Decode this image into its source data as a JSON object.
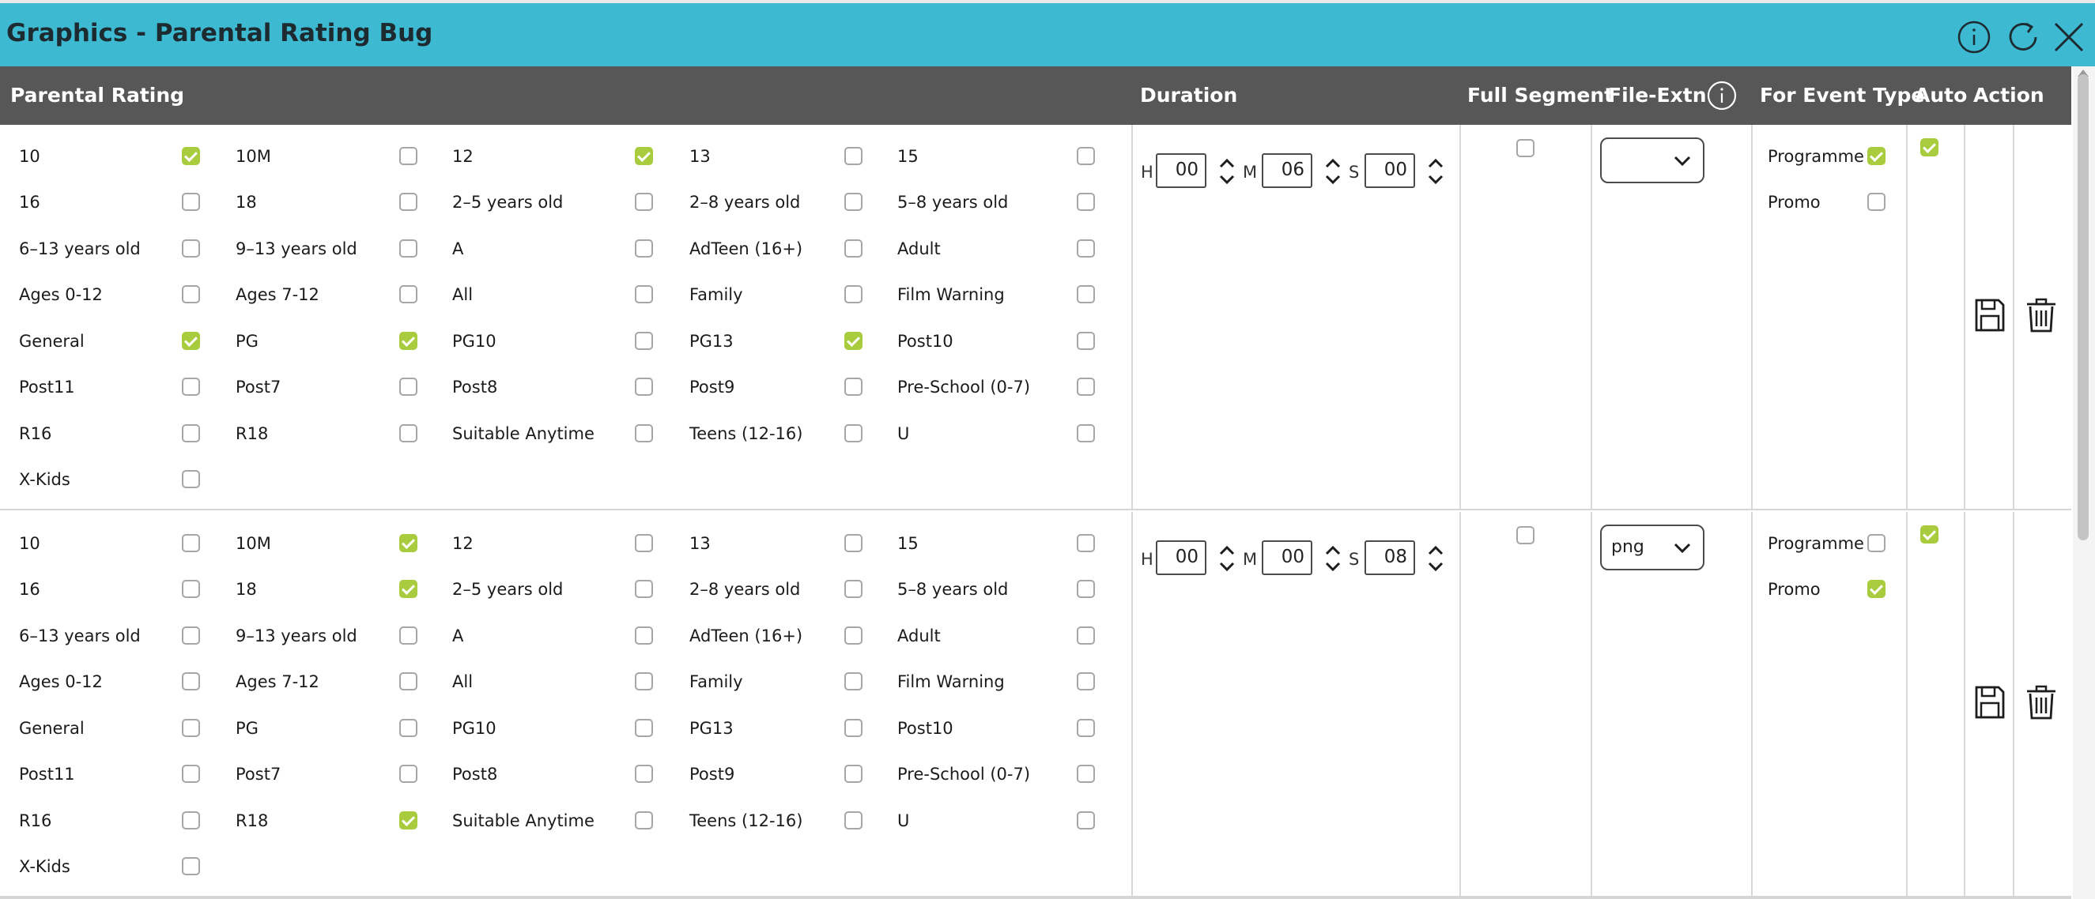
{
  "window": {
    "title": "Graphics - Parental Rating Bug",
    "icons": [
      "info-icon",
      "refresh-icon",
      "close-icon"
    ]
  },
  "columns": {
    "parental_rating": "Parental Rating",
    "duration": "Duration",
    "full_segment": "Full Segment",
    "file_extn": "File-Extn",
    "for_event_type": "For Event Type",
    "auto": "Auto",
    "action": "Action"
  },
  "colors": {
    "title_bar": "#3dbad2",
    "header": "#575757",
    "checked": "#a8cc3e"
  },
  "duration_letters": {
    "h": "H",
    "m": "M",
    "s": "S"
  },
  "event_types": [
    "Programme",
    "Promo"
  ],
  "rows": [
    {
      "ratings": [
        {
          "label": "10",
          "checked": true
        },
        {
          "label": "10M",
          "checked": false
        },
        {
          "label": "12",
          "checked": true
        },
        {
          "label": "13",
          "checked": false
        },
        {
          "label": "15",
          "checked": false
        },
        {
          "label": "16",
          "checked": false
        },
        {
          "label": "18",
          "checked": false
        },
        {
          "label": "2–5 years old",
          "checked": false
        },
        {
          "label": "2–8 years old",
          "checked": false
        },
        {
          "label": "5–8 years old",
          "checked": false
        },
        {
          "label": "6–13 years old",
          "checked": false
        },
        {
          "label": "9–13 years old",
          "checked": false
        },
        {
          "label": "A",
          "checked": false
        },
        {
          "label": "AdTeen (16+)",
          "checked": false
        },
        {
          "label": "Adult",
          "checked": false
        },
        {
          "label": "Ages 0-12",
          "checked": false
        },
        {
          "label": "Ages 7-12",
          "checked": false
        },
        {
          "label": "All",
          "checked": false
        },
        {
          "label": "Family",
          "checked": false
        },
        {
          "label": "Film Warning",
          "checked": false
        },
        {
          "label": "General",
          "checked": true
        },
        {
          "label": "PG",
          "checked": true
        },
        {
          "label": "PG10",
          "checked": false
        },
        {
          "label": "PG13",
          "checked": true
        },
        {
          "label": "Post10",
          "checked": false
        },
        {
          "label": "Post11",
          "checked": false
        },
        {
          "label": "Post7",
          "checked": false
        },
        {
          "label": "Post8",
          "checked": false
        },
        {
          "label": "Post9",
          "checked": false
        },
        {
          "label": "Pre-School (0-7)",
          "checked": false
        },
        {
          "label": "R16",
          "checked": false
        },
        {
          "label": "R18",
          "checked": false
        },
        {
          "label": "Suitable Anytime",
          "checked": false
        },
        {
          "label": "Teens (12-16)",
          "checked": false
        },
        {
          "label": "U",
          "checked": false
        },
        {
          "label": "X-Kids",
          "checked": false
        }
      ],
      "duration": {
        "h": "00",
        "m": "06",
        "s": "00"
      },
      "full_segment": false,
      "file_extn": "",
      "event_checked": [
        true,
        false
      ],
      "auto": true
    },
    {
      "ratings": [
        {
          "label": "10",
          "checked": false
        },
        {
          "label": "10M",
          "checked": true
        },
        {
          "label": "12",
          "checked": false
        },
        {
          "label": "13",
          "checked": false
        },
        {
          "label": "15",
          "checked": false
        },
        {
          "label": "16",
          "checked": false
        },
        {
          "label": "18",
          "checked": true
        },
        {
          "label": "2–5 years old",
          "checked": false
        },
        {
          "label": "2–8 years old",
          "checked": false
        },
        {
          "label": "5–8 years old",
          "checked": false
        },
        {
          "label": "6–13 years old",
          "checked": false
        },
        {
          "label": "9–13 years old",
          "checked": false
        },
        {
          "label": "A",
          "checked": false
        },
        {
          "label": "AdTeen (16+)",
          "checked": false
        },
        {
          "label": "Adult",
          "checked": false
        },
        {
          "label": "Ages 0-12",
          "checked": false
        },
        {
          "label": "Ages 7-12",
          "checked": false
        },
        {
          "label": "All",
          "checked": false
        },
        {
          "label": "Family",
          "checked": false
        },
        {
          "label": "Film Warning",
          "checked": false
        },
        {
          "label": "General",
          "checked": false
        },
        {
          "label": "PG",
          "checked": false
        },
        {
          "label": "PG10",
          "checked": false
        },
        {
          "label": "PG13",
          "checked": false
        },
        {
          "label": "Post10",
          "checked": false
        },
        {
          "label": "Post11",
          "checked": false
        },
        {
          "label": "Post7",
          "checked": false
        },
        {
          "label": "Post8",
          "checked": false
        },
        {
          "label": "Post9",
          "checked": false
        },
        {
          "label": "Pre-School (0-7)",
          "checked": false
        },
        {
          "label": "R16",
          "checked": false
        },
        {
          "label": "R18",
          "checked": true
        },
        {
          "label": "Suitable Anytime",
          "checked": false
        },
        {
          "label": "Teens (12-16)",
          "checked": false
        },
        {
          "label": "U",
          "checked": false
        },
        {
          "label": "X-Kids",
          "checked": false
        }
      ],
      "duration": {
        "h": "00",
        "m": "00",
        "s": "08"
      },
      "full_segment": false,
      "file_extn": "png",
      "event_checked": [
        false,
        true
      ],
      "auto": true
    }
  ]
}
